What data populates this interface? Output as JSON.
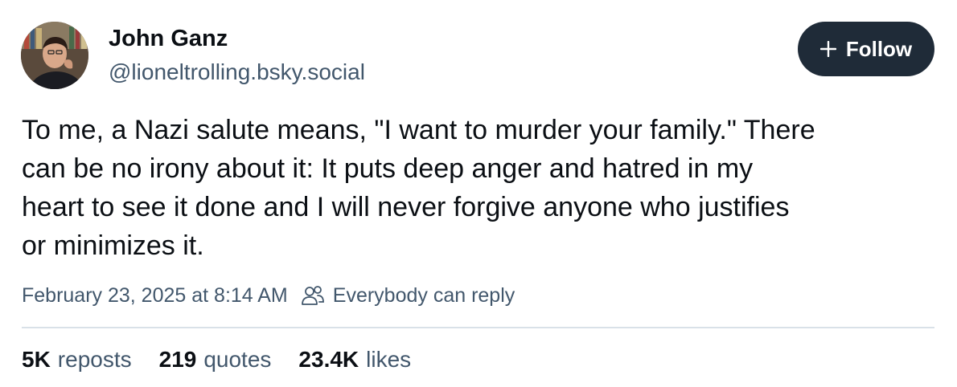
{
  "author": {
    "name": "John Ganz",
    "handle": "@lioneltrolling.bsky.social"
  },
  "follow_button": {
    "label": "Follow",
    "icon": "plus-icon"
  },
  "post": {
    "text_lines": [
      "To me, a Nazi salute means, \"I want to murder your family.\" There",
      "can be no irony about it: It puts deep anger and hatred in my",
      "heart to see it done and I will never forgive anyone who justifies",
      "or minimizes it."
    ],
    "timestamp": "February 23, 2025 at 8:14 AM",
    "reply_setting": "Everybody can reply",
    "reply_icon": "people-icon"
  },
  "stats": [
    {
      "count": "5K",
      "label": "reposts"
    },
    {
      "count": "219",
      "label": "quotes"
    },
    {
      "count": "23.4K",
      "label": "likes"
    }
  ],
  "colors": {
    "text_primary": "#0b0f14",
    "text_secondary": "#42576c",
    "follow_button_bg": "#1f2b38",
    "divider": "#d9e1e8"
  }
}
